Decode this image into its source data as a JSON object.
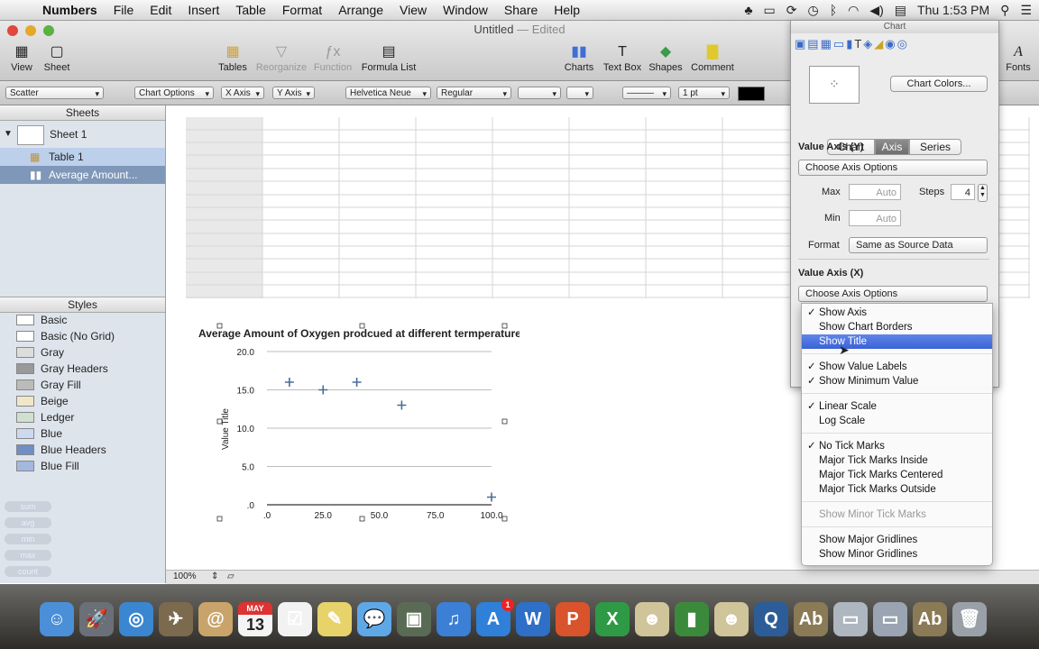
{
  "menubar": {
    "app": "Numbers",
    "items": [
      "File",
      "Edit",
      "Insert",
      "Table",
      "Format",
      "Arrange",
      "View",
      "Window",
      "Share",
      "Help"
    ],
    "clock": "Thu 1:53 PM"
  },
  "window": {
    "title": "Untitled",
    "edited": "— Edited"
  },
  "toolbar": {
    "view": "View",
    "sheet": "Sheet",
    "tables": "Tables",
    "reorganize": "Reorganize",
    "function": "Function",
    "formula_list": "Formula List",
    "charts": "Charts",
    "text_box": "Text Box",
    "shapes": "Shapes",
    "comment": "Comment",
    "fonts": "Fonts"
  },
  "formatbar": {
    "chart_type": "Scatter",
    "chart_options": "Chart Options",
    "x_axis": "X Axis",
    "y_axis": "Y Axis",
    "font": "Helvetica Neue",
    "weight": "Regular",
    "stroke": "1 pt"
  },
  "sidebar": {
    "sheets_header": "Sheets",
    "sheet1": "Sheet 1",
    "table1": "Table 1",
    "chart_item": "Average Amount...",
    "styles_header": "Styles",
    "styles": [
      "Basic",
      "Basic (No Grid)",
      "Gray",
      "Gray Headers",
      "Gray Fill",
      "Beige",
      "Ledger",
      "Blue",
      "Blue Headers",
      "Blue Fill"
    ],
    "quick_calc": [
      "sum",
      "avg",
      "min",
      "max",
      "count"
    ]
  },
  "bottombar": {
    "zoom": "100%"
  },
  "chart_data": {
    "type": "scatter",
    "title": "Average Amount of Oxygen prodcued at different termperatures",
    "ylabel": "Value Title",
    "xlabel": "",
    "x_ticks": [
      ".0",
      "25.0",
      "50.0",
      "75.0",
      "100.0"
    ],
    "y_ticks": [
      "20.0",
      "15.0",
      "10.0",
      "5.0",
      ".0"
    ],
    "xlim": [
      0,
      100
    ],
    "ylim": [
      0,
      20
    ],
    "grid": "horizontal",
    "series": [
      {
        "points": [
          [
            10,
            16
          ],
          [
            25,
            15
          ],
          [
            40,
            16
          ],
          [
            60,
            13
          ],
          [
            100,
            1
          ]
        ]
      }
    ]
  },
  "inspector": {
    "title": "Chart",
    "chart_colors": "Chart Colors...",
    "tabs": [
      "Chart",
      "Axis",
      "Series"
    ],
    "active_tab": "Axis",
    "value_axis_y": "Value Axis (Y)",
    "choose_axis_options_y": "Choose Axis Options",
    "max_label": "Max",
    "max_placeholder": "Auto",
    "steps_label": "Steps",
    "steps_value": "4",
    "min_label": "Min",
    "min_placeholder": "Auto",
    "format_label": "Format",
    "format_value": "Same as Source Data",
    "value_axis_x": "Value Axis (X)",
    "choose_axis_options_x": "Choose Axis Options"
  },
  "dropdown": {
    "groups": [
      [
        {
          "label": "Show Axis",
          "checked": true
        },
        {
          "label": "Show Chart Borders",
          "checked": false
        },
        {
          "label": "Show Title",
          "checked": false,
          "selected": true
        }
      ],
      [
        {
          "label": "Show Value Labels",
          "checked": true
        },
        {
          "label": "Show Minimum Value",
          "checked": true
        }
      ],
      [
        {
          "label": "Linear Scale",
          "checked": true
        },
        {
          "label": "Log Scale",
          "checked": false
        }
      ],
      [
        {
          "label": "No Tick Marks",
          "checked": true
        },
        {
          "label": "Major Tick Marks Inside",
          "checked": false
        },
        {
          "label": "Major Tick Marks Centered",
          "checked": false
        },
        {
          "label": "Major Tick Marks Outside",
          "checked": false
        }
      ],
      [
        {
          "label": "Show Minor Tick Marks",
          "checked": false,
          "disabled": true
        }
      ],
      [
        {
          "label": "Show Major Gridlines",
          "checked": false
        },
        {
          "label": "Show Minor Gridlines",
          "checked": false
        }
      ]
    ]
  },
  "dock": {
    "badge": "1",
    "calendar_month": "MAY",
    "calendar_day": "13"
  }
}
